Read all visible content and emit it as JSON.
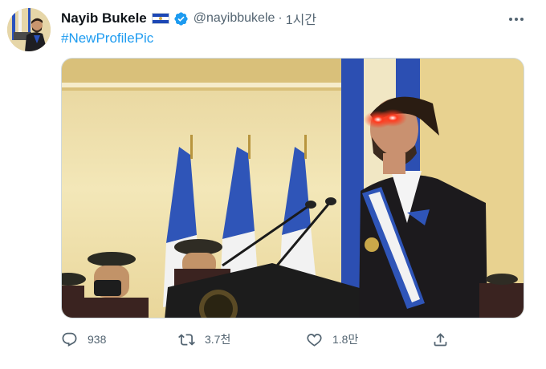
{
  "tweet": {
    "display_name": "Nayib Bukele",
    "handle": "@nayibbukele",
    "separator": "·",
    "time": "1시간",
    "hashtag": "#NewProfilePic",
    "flag_icon": "el-salvador-flag-icon",
    "verified_icon": "verified-badge-icon"
  },
  "actions": {
    "replies": "938",
    "retweets": "3.7천",
    "likes": "1.8만"
  },
  "colors": {
    "link": "#1d9bf0",
    "muted": "#536471",
    "verified": "#1d9bf0"
  }
}
